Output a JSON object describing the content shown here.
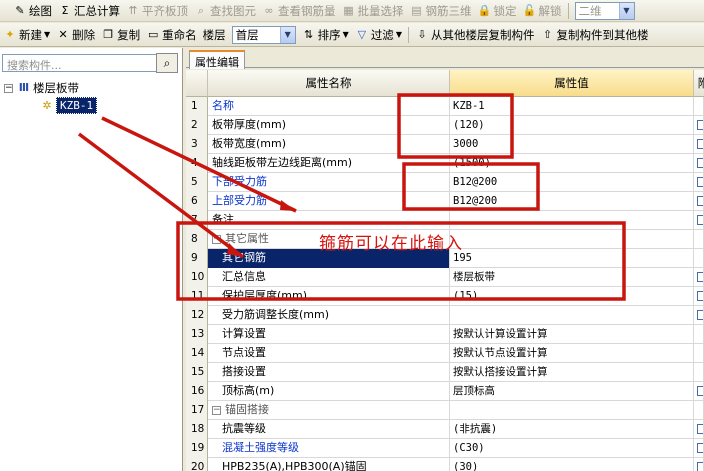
{
  "toolbar1": {
    "items": [
      {
        "label": "绘图",
        "icon": "pencil-icon",
        "disabled": false
      },
      {
        "label": "汇总计算",
        "icon": "sigma-icon",
        "disabled": false
      },
      {
        "label": "平齐板顶",
        "icon": "align-top-icon",
        "disabled": true
      },
      {
        "label": "查找图元",
        "icon": "find-icon",
        "disabled": true
      },
      {
        "label": "查看钢筋量",
        "icon": "view-rebar-icon",
        "disabled": true
      },
      {
        "label": "批量选择",
        "icon": "batch-select-icon",
        "disabled": true
      },
      {
        "label": "钢筋三维",
        "icon": "rebar-3d-icon",
        "disabled": true
      },
      {
        "label": "锁定",
        "icon": "lock-icon",
        "disabled": true
      },
      {
        "label": "解锁",
        "icon": "unlock-icon",
        "disabled": true
      }
    ],
    "view_mode": "二维"
  },
  "toolbar2": {
    "new_label": "新建",
    "delete_label": "删除",
    "copy_label": "复制",
    "rename_label": "重命名",
    "floor_label": "楼层",
    "floor_value": "首层",
    "sort_label": "排序",
    "filter_label": "过滤",
    "copy_from_label": "从其他楼层复制构件",
    "copy_to_label": "复制构件到其他楼"
  },
  "sidebar": {
    "search_placeholder": "搜索构件...",
    "tree_root": "楼层板带",
    "tree_child": "KZB-1"
  },
  "tab_label": "属性编辑",
  "grid": {
    "col_name": "属性名称",
    "col_value": "属性值",
    "col_attach": "附",
    "rows": [
      {
        "num": "1",
        "name": "名称",
        "value": "KZB-1",
        "style": "blue",
        "check": false
      },
      {
        "num": "2",
        "name": "板带厚度(mm)",
        "value": "(120)",
        "style": "",
        "check": true
      },
      {
        "num": "3",
        "name": "板带宽度(mm)",
        "value": "3000",
        "style": "",
        "check": true
      },
      {
        "num": "4",
        "name": "轴线距板带左边线距离(mm)",
        "value": "(1500)",
        "style": "",
        "check": true
      },
      {
        "num": "5",
        "name": "下部受力筋",
        "value": "B12@200",
        "style": "blue",
        "check": true
      },
      {
        "num": "6",
        "name": "上部受力筋",
        "value": "B12@200",
        "style": "blue",
        "check": true
      },
      {
        "num": "7",
        "name": "备注",
        "value": "",
        "style": "",
        "check": true
      },
      {
        "num": "8",
        "name": "其它属性",
        "value": "",
        "style": "group",
        "check": false
      },
      {
        "num": "9",
        "name": "其它钢筋",
        "value": "195",
        "style": "selected",
        "check": false
      },
      {
        "num": "10",
        "name": "汇总信息",
        "value": "楼层板带",
        "style": "indent",
        "check": true
      },
      {
        "num": "11",
        "name": "保护层厚度(mm)",
        "value": "(15)",
        "style": "indent",
        "check": true
      },
      {
        "num": "12",
        "name": "受力筋调整长度(mm)",
        "value": "",
        "style": "indent",
        "check": true
      },
      {
        "num": "13",
        "name": "计算设置",
        "value": "按默认计算设置计算",
        "style": "indent",
        "check": false
      },
      {
        "num": "14",
        "name": "节点设置",
        "value": "按默认节点设置计算",
        "style": "indent",
        "check": false
      },
      {
        "num": "15",
        "name": "搭接设置",
        "value": "按默认搭接设置计算",
        "style": "indent",
        "check": false
      },
      {
        "num": "16",
        "name": "顶标高(m)",
        "value": "层顶标高",
        "style": "indent",
        "check": true
      },
      {
        "num": "17",
        "name": "锚固搭接",
        "value": "",
        "style": "group",
        "check": false
      },
      {
        "num": "18",
        "name": "抗震等级",
        "value": "(非抗震)",
        "style": "indent",
        "check": true
      },
      {
        "num": "19",
        "name": "混凝土强度等级",
        "value": "(C30)",
        "style": "indent-blue",
        "check": true
      },
      {
        "num": "20",
        "name": "HPB235(A),HPB300(A)锚固",
        "value": "(30)",
        "style": "indent",
        "check": true
      }
    ]
  },
  "annotation": {
    "text": "箍筋可以在此输入",
    "color": "#d5140f"
  },
  "colors": {
    "selection": "#0a246a",
    "header_value": "#f8dc8a",
    "blue_text": "#0b35c9"
  }
}
